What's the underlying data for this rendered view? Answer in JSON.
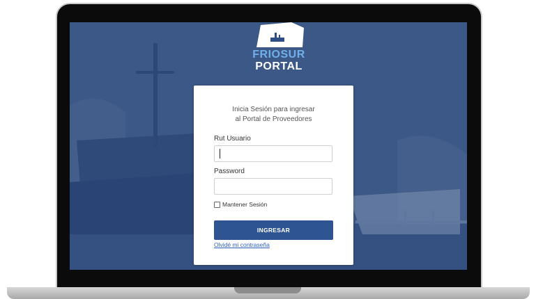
{
  "logo": {
    "line1": "FRIOSUR",
    "line2": "PORTAL"
  },
  "login": {
    "intro_line1": "Inicia Sesión para ingresar",
    "intro_line2": "al Portal de Proveedores",
    "rut_label": "Rut Usuario",
    "rut_value": "",
    "password_label": "Password",
    "password_value": "",
    "remember_label": "Mantener Sesión",
    "remember_checked": false,
    "submit_label": "INGRESAR",
    "forgot_label": "Olvidé mi contraseña"
  },
  "colors": {
    "background_tint": "#35507e",
    "button": "#2e5592",
    "link": "#2d5fc1",
    "logo_accent": "#6fb0ea"
  }
}
